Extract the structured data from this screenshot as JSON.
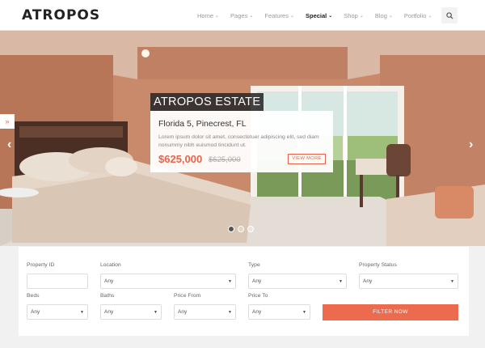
{
  "brand": {
    "logo": "ATROPOS",
    "accent": "#e8634a"
  },
  "nav": [
    {
      "label": "Home",
      "active": false
    },
    {
      "label": "Pages",
      "active": false
    },
    {
      "label": "Features",
      "active": false
    },
    {
      "label": "Special",
      "active": true
    },
    {
      "label": "Shop",
      "active": false
    },
    {
      "label": "Blog",
      "active": false
    },
    {
      "label": "Portfolio",
      "active": false
    }
  ],
  "hero": {
    "title": "ATROPOS ESTATE",
    "address": "Florida 5, Pinecrest, FL",
    "description": "Lorem ipsum dolor sit amet, consectetuer adipiscing elit, sed diam nonummy nibh euismod tincidunt ut.",
    "price": "$625,000",
    "old_price": "$625,000",
    "button": "VIEW MORE",
    "slides": 3,
    "active_slide": 1
  },
  "search": {
    "property_id": {
      "label": "Property ID",
      "value": ""
    },
    "location": {
      "label": "Location",
      "value": "Any"
    },
    "type": {
      "label": "Type",
      "value": "Any"
    },
    "status": {
      "label": "Property Status",
      "value": "Any"
    },
    "beds": {
      "label": "Beds",
      "value": "Any"
    },
    "baths": {
      "label": "Baths",
      "value": "Any"
    },
    "price_from": {
      "label": "Price From",
      "value": "Any"
    },
    "price_to": {
      "label": "Price To",
      "value": "Any"
    },
    "button": "FILTER NOW"
  }
}
